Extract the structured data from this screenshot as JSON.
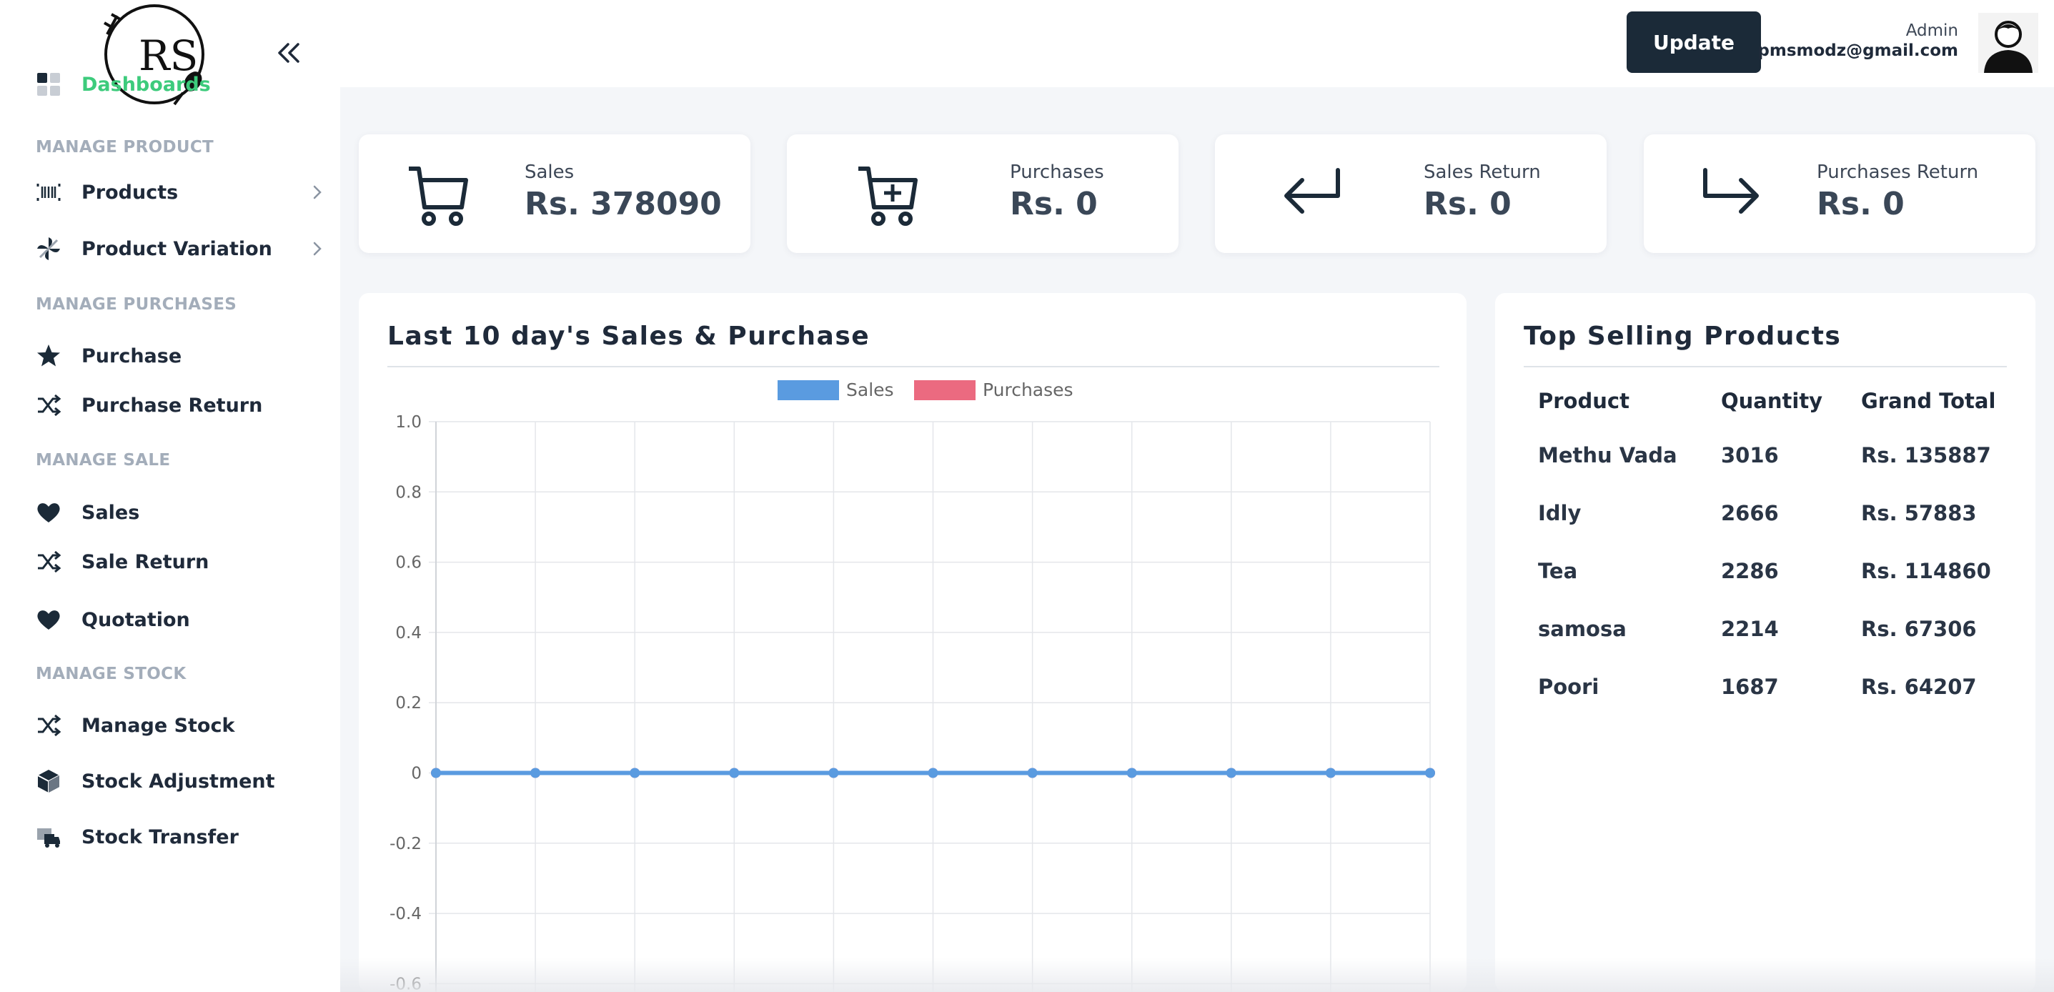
{
  "sidebar": {
    "logo_text": "RS",
    "nav": [
      {
        "type": "item",
        "label": "Dashboards",
        "icon": "grid-icon",
        "active": true
      },
      {
        "type": "section",
        "label": "MANAGE PRODUCT"
      },
      {
        "type": "item",
        "label": "Products",
        "icon": "barcode-icon",
        "chevron": true
      },
      {
        "type": "item",
        "label": "Product Variation",
        "icon": "pinwheel-icon",
        "chevron": true
      },
      {
        "type": "section",
        "label": "MANAGE PURCHASES"
      },
      {
        "type": "item",
        "label": "Purchase",
        "icon": "star-icon"
      },
      {
        "type": "item",
        "label": "Purchase Return",
        "icon": "shuffle-icon"
      },
      {
        "type": "section",
        "label": "MANAGE SALE"
      },
      {
        "type": "item",
        "label": "Sales",
        "icon": "heart-icon"
      },
      {
        "type": "item",
        "label": "Sale Return",
        "icon": "shuffle-icon"
      },
      {
        "type": "item",
        "label": "Quotation",
        "icon": "heart-icon"
      },
      {
        "type": "section",
        "label": "MANAGE STOCK"
      },
      {
        "type": "item",
        "label": "Manage Stock",
        "icon": "shuffle-icon"
      },
      {
        "type": "item",
        "label": "Stock Adjustment",
        "icon": "cube-icon"
      },
      {
        "type": "item",
        "label": "Stock Transfer",
        "icon": "truck-icon"
      }
    ]
  },
  "topbar": {
    "update_label": "Update",
    "user_role": "Admin",
    "user_email": "pmsmodz@gmail.com"
  },
  "stats": [
    {
      "label": "Sales",
      "value": "Rs. 378090",
      "icon": "cart-icon"
    },
    {
      "label": "Purchases",
      "value": "Rs. 0",
      "icon": "cart-plus-icon"
    },
    {
      "label": "Sales Return",
      "value": "Rs. 0",
      "icon": "return-left-icon"
    },
    {
      "label": "Purchases Return",
      "value": "Rs. 0",
      "icon": "return-right-icon"
    }
  ],
  "sales_chart": {
    "title": "Last 10 day's Sales & Purchase"
  },
  "chart_data": {
    "type": "line",
    "title": "Last 10 day's Sales & Purchase",
    "x_count": 11,
    "yticks": [
      "1.0",
      "0.8",
      "0.6",
      "0.4",
      "0.2",
      "0",
      "-0.2",
      "-0.4",
      "-0.6"
    ],
    "ylim": [
      -0.6,
      1.0
    ],
    "grid": true,
    "legend_position": "top-center",
    "series": [
      {
        "name": "Sales",
        "color": "#5a9be0",
        "values": [
          0,
          0,
          0,
          0,
          0,
          0,
          0,
          0,
          0,
          0,
          0
        ]
      },
      {
        "name": "Purchases",
        "color": "#eb6a80",
        "values": [
          0,
          0,
          0,
          0,
          0,
          0,
          0,
          0,
          0,
          0,
          0
        ]
      }
    ]
  },
  "top_selling": {
    "title": "Top Selling Products",
    "headers": [
      "Product",
      "Quantity",
      "Grand Total"
    ],
    "rows": [
      [
        "Methu Vada",
        "3016",
        "Rs. 135887"
      ],
      [
        "Idly",
        "2666",
        "Rs. 57883"
      ],
      [
        "Tea",
        "2286",
        "Rs. 114860"
      ],
      [
        "samosa",
        "2214",
        "Rs. 67306"
      ],
      [
        "Poori",
        "1687",
        "Rs. 64207"
      ]
    ]
  }
}
